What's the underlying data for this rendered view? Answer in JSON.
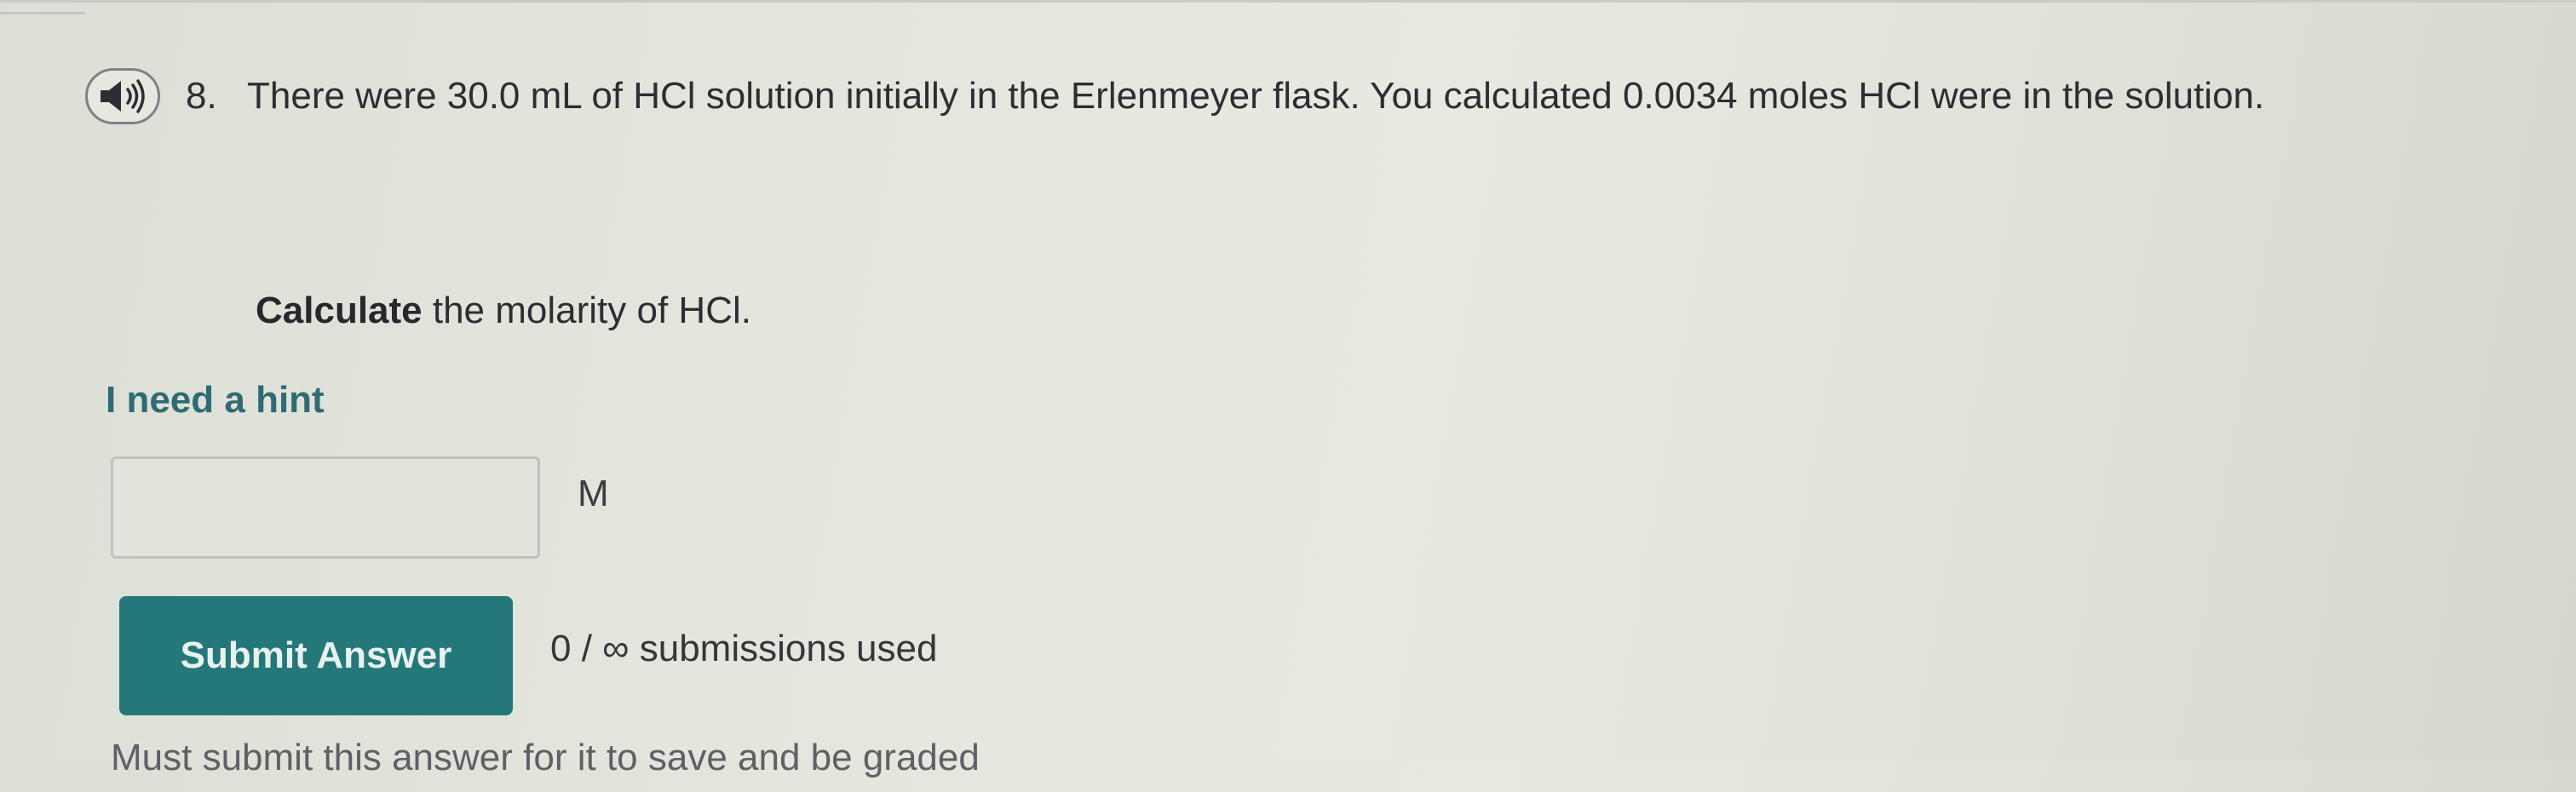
{
  "question": {
    "number": "8.",
    "text": "There were 30.0 mL of HCl solution initially in the Erlenmeyer flask. You calculated 0.0034 moles HCl were in the solution.",
    "instruction_bold": "Calculate",
    "instruction_rest": " the molarity of HCl.",
    "audio_icon": "speaker-icon"
  },
  "hint": {
    "label": "I need a hint"
  },
  "answer": {
    "value": "",
    "unit": "M"
  },
  "submit": {
    "label": "Submit Answer",
    "status": "0 / ∞ submissions used"
  },
  "footer": {
    "partial_text": "Must submit this answer for it to save and be graded"
  },
  "colors": {
    "accent": "#25787a",
    "hint_link": "#2f6b72",
    "text": "#2b2f33",
    "background": "#e4e6dd"
  }
}
